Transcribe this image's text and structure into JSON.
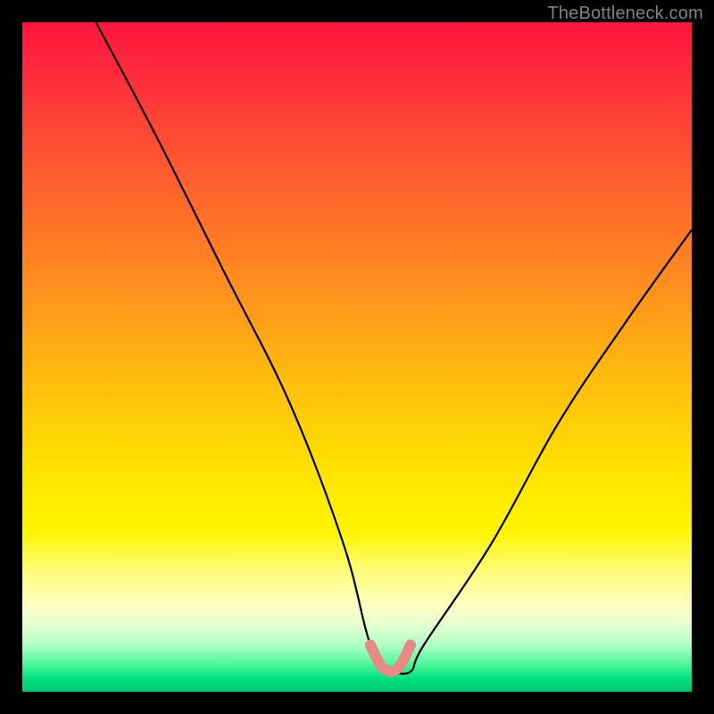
{
  "watermark": "TheBottleneck.com",
  "chart_data": {
    "type": "line",
    "title": "",
    "xlabel": "",
    "ylabel": "",
    "xlim": [
      0,
      100
    ],
    "ylim": [
      0,
      100
    ],
    "grid": false,
    "series": [
      {
        "name": "bottleneck-curve",
        "color": "#000000",
        "x": [
          11,
          20,
          30,
          40,
          48,
          52,
          55,
          58,
          60,
          70,
          80,
          90,
          100
        ],
        "y": [
          100,
          83,
          63,
          43,
          22,
          7,
          3,
          3,
          7,
          22,
          40,
          55,
          69
        ]
      }
    ],
    "highlight": {
      "name": "optimal-range",
      "color": "#e88a86",
      "x": [
        52,
        53.5,
        55,
        56.5,
        58
      ],
      "y": [
        7,
        4,
        3,
        4,
        7
      ]
    },
    "background": "vertical-gradient-red-to-green"
  }
}
